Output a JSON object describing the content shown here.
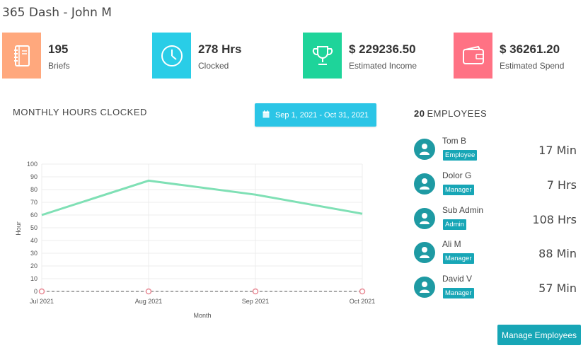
{
  "page": {
    "title": "365 Dash - John M"
  },
  "stats": [
    {
      "value": "195",
      "label": "Briefs",
      "color": "#ffa87d",
      "icon": "notebook-icon"
    },
    {
      "value": "278 Hrs",
      "label": "Clocked",
      "color": "#29cde7",
      "icon": "clock-icon"
    },
    {
      "value": "$ 229236.50",
      "label": "Estimated Income",
      "color": "#1ed49a",
      "icon": "trophy-icon"
    },
    {
      "value": "$ 36261.20",
      "label": "Estimated Spend",
      "color": "#ff7284",
      "icon": "wallet-icon"
    }
  ],
  "hours_section": {
    "title": "MONTHLY HOURS CLOCKED",
    "date_range": "Sep 1, 2021 - Oct 31, 2021"
  },
  "employees": {
    "count": "20",
    "label": "EMPLOYEES",
    "list": [
      {
        "name": "Tom B",
        "role": "Employee",
        "time": "17 Min"
      },
      {
        "name": "Dolor G",
        "role": "Manager",
        "time": "7 Hrs"
      },
      {
        "name": "Sub Admin",
        "role": "Admin",
        "time": "108 Hrs"
      },
      {
        "name": "Ali M",
        "role": "Manager",
        "time": "88 Min"
      },
      {
        "name": "David V",
        "role": "Manager",
        "time": "57 Min"
      }
    ],
    "manage_label": "Manage Employees"
  },
  "colors": {
    "accent": "#17a6b6",
    "line": "#7fe0b5",
    "baseline": "#e88a95"
  },
  "chart_data": {
    "type": "line",
    "categories": [
      "Jul 2021",
      "Aug 2021",
      "Sep 2021",
      "Oct 2021"
    ],
    "series": [
      {
        "values": [
          60,
          87,
          76,
          61
        ]
      },
      {
        "values": [
          0,
          0,
          0,
          0
        ]
      }
    ],
    "xlabel": "Month",
    "ylabel": "Hour",
    "ylim": [
      0,
      100
    ],
    "yticks": [
      0,
      10,
      20,
      30,
      40,
      50,
      60,
      70,
      80,
      90,
      100
    ],
    "grid": true
  }
}
